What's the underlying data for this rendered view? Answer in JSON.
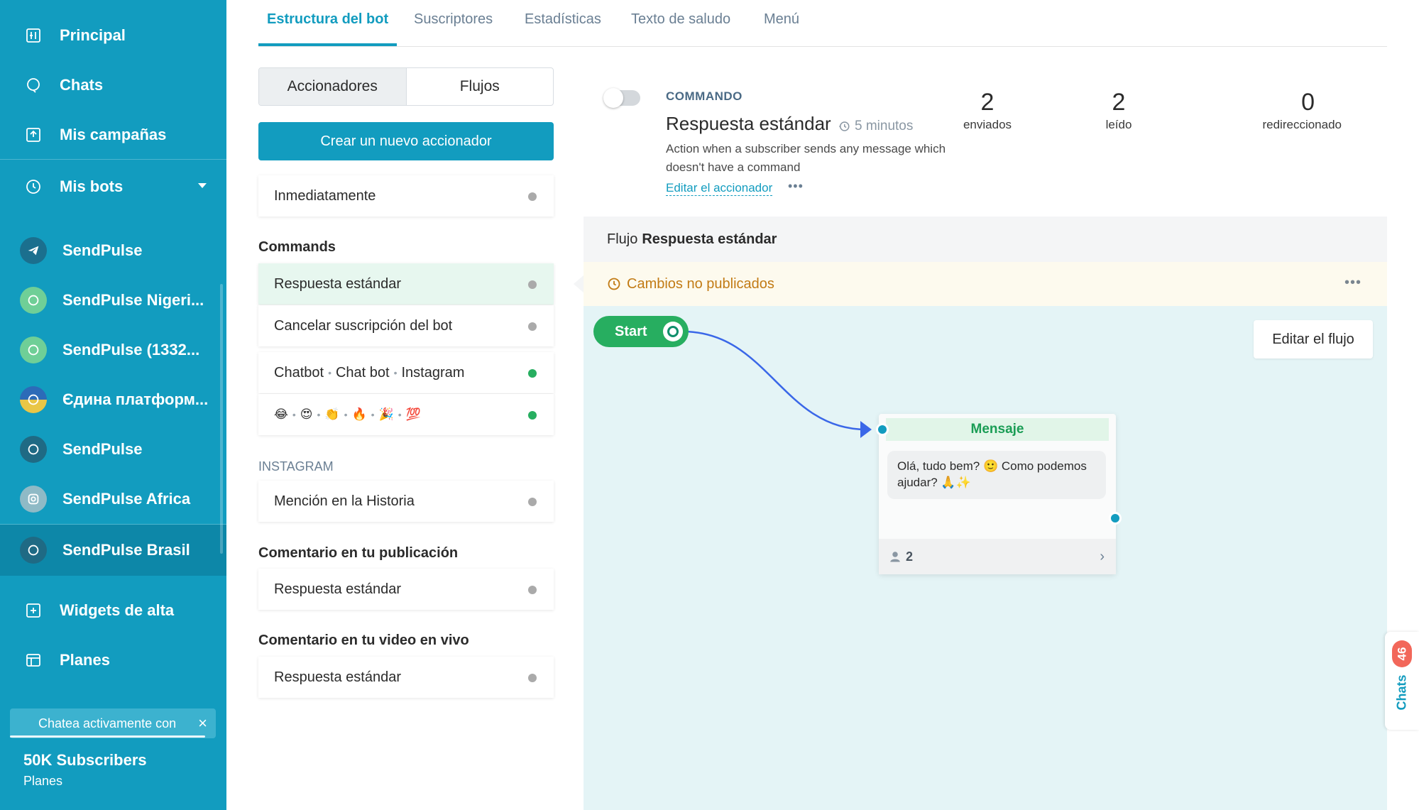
{
  "sidebar": {
    "nav": [
      {
        "label": "Principal",
        "icon": "home-icon"
      },
      {
        "label": "Chats",
        "icon": "chat-bubble-icon"
      },
      {
        "label": "Mis campañas",
        "icon": "upload-icon"
      },
      {
        "label": "Mis bots",
        "icon": "clock-icon"
      }
    ],
    "bots": [
      {
        "label": "SendPulse",
        "icon": "telegram-icon"
      },
      {
        "label": "SendPulse Nigeri...",
        "icon": "whatsapp-icon"
      },
      {
        "label": "SendPulse (1332...",
        "icon": "whatsapp-icon"
      },
      {
        "label": "Єдина платформ...",
        "icon": "viber-icon"
      },
      {
        "label": "SendPulse",
        "icon": "viber-icon"
      },
      {
        "label": "SendPulse Africa",
        "icon": "instagram-icon"
      },
      {
        "label": "SendPulse Brasil",
        "icon": "viber-icon"
      }
    ],
    "bottom_nav": [
      {
        "label": "Widgets de alta",
        "icon": "widget-icon"
      },
      {
        "label": "Planes",
        "icon": "card-icon"
      }
    ],
    "banner": "Chatea activamente con",
    "subscription_title": "50K Subscribers",
    "subscription_link": "Planes"
  },
  "tabs": [
    "Estructura del bot",
    "Suscriptores",
    "Estadísticas",
    "Texto de saludo",
    "Menú"
  ],
  "segment": {
    "left": "Accionadores",
    "right": "Flujos"
  },
  "create_button": "Crear un nuevo accionador",
  "immediately": "Inmediatamente",
  "sections": {
    "commands": "Commands",
    "instagram": "INSTAGRAM",
    "post_comment": "Comentario en tu publicación",
    "live_comment": "Comentario en tu video en vivo"
  },
  "command_triggers": [
    "Respuesta estándar",
    "Cancelar suscripción del bot"
  ],
  "keyword_trigger": [
    "Chatbot",
    "Chat bot",
    "Instagram"
  ],
  "emoji_trigger": [
    "😂",
    "😍",
    "👏",
    "🔥",
    "🎉",
    "💯"
  ],
  "instagram_trigger": "Mención en la Historia",
  "post_comment_trigger": "Respuesta estándar",
  "live_comment_trigger": "Respuesta estándar",
  "info": {
    "label": "COMMANDO",
    "title": "Respuesta estándar",
    "time": "5 minutos",
    "description": "Action when a subscriber sends any message which doesn't have a command",
    "edit_link": "Editar el accionador",
    "more": "•••",
    "stats": [
      {
        "value": "2",
        "label": "enviados"
      },
      {
        "value": "2",
        "label": "leído"
      },
      {
        "value": "0",
        "label": "redireccionado"
      }
    ]
  },
  "flow": {
    "prefix": "Flujo",
    "name": "Respuesta estándar",
    "unpublished": "Cambios no publicados",
    "more": "•••",
    "edit_button": "Editar el flujo",
    "start_label": "Start",
    "message": {
      "header": "Mensaje",
      "text": "Olá, tudo bem? 🙂 Como podemos ajudar? 🙏✨",
      "recipients": "2"
    }
  },
  "chats_widget": {
    "badge": "46",
    "label": "Chats"
  },
  "colors": {
    "accent": "#129cbf",
    "sidebar": "#129cbf",
    "green": "#27ae60",
    "warning": "#c27b15"
  }
}
